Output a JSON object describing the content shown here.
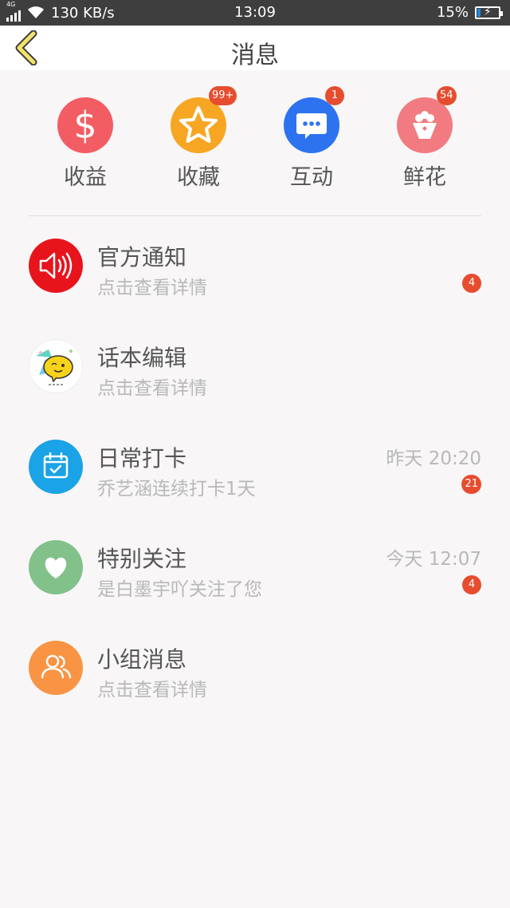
{
  "status_bar": {
    "network": "4G",
    "speed": "130 KB/s",
    "time": "13:09",
    "battery": "15%",
    "battery_level": 0.15
  },
  "header": {
    "title": "消息",
    "back_icon": "chevron-left-icon"
  },
  "categories": [
    {
      "label": "收益",
      "icon": "dollar-icon",
      "color": "#f25d63",
      "badge": ""
    },
    {
      "label": "收藏",
      "icon": "star-icon",
      "color": "#f6a623",
      "badge": "99+"
    },
    {
      "label": "互动",
      "icon": "chat-bubble-icon",
      "color": "#2d73f0",
      "badge": "1"
    },
    {
      "label": "鲜花",
      "icon": "flower-bouquet-icon",
      "color": "#f17b80",
      "badge": "54"
    }
  ],
  "messages": [
    {
      "name": "官方通知",
      "sub": "点击查看详情",
      "time": "",
      "count": "4",
      "icon": "speaker-icon",
      "color": "#e8141c"
    },
    {
      "name": "话本编辑",
      "sub": "点击查看详情",
      "time": "",
      "count": "",
      "icon": "cartoon-face-icon",
      "color": "#ffffff"
    },
    {
      "name": "日常打卡",
      "sub": "乔艺涵连续打卡1天",
      "time": "昨天 20:20",
      "count": "21",
      "icon": "calendar-check-icon",
      "color": "#1aa3e6"
    },
    {
      "name": "特别关注",
      "sub": "是白墨宇吖关注了您",
      "time": "今天 12:07",
      "count": "4",
      "icon": "heart-icon",
      "color": "#82c18a"
    },
    {
      "name": "小组消息",
      "sub": "点击查看详情",
      "time": "",
      "count": "",
      "icon": "group-icon",
      "color": "#f89443"
    }
  ]
}
